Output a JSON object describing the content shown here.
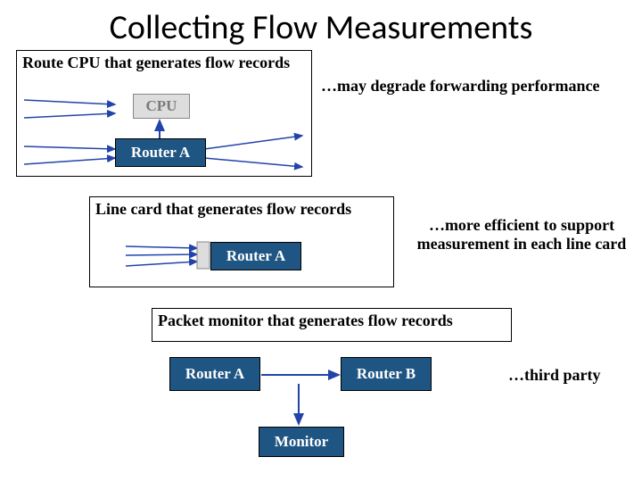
{
  "title": "Collecting Flow Measurements",
  "panels": {
    "p1": {
      "header": "Route CPU that generates flow records",
      "note": "…may degrade forwarding performance",
      "cpu": "CPU",
      "router": "Router A"
    },
    "p2": {
      "header": "Line card that generates flow records",
      "note": "…more efficient to support measurement in each line card",
      "router": "Router A"
    },
    "p3": {
      "header": "Packet monitor that generates flow records",
      "note": "…third party",
      "routerA": "Router A",
      "routerB": "Router B",
      "monitor": "Monitor"
    }
  }
}
